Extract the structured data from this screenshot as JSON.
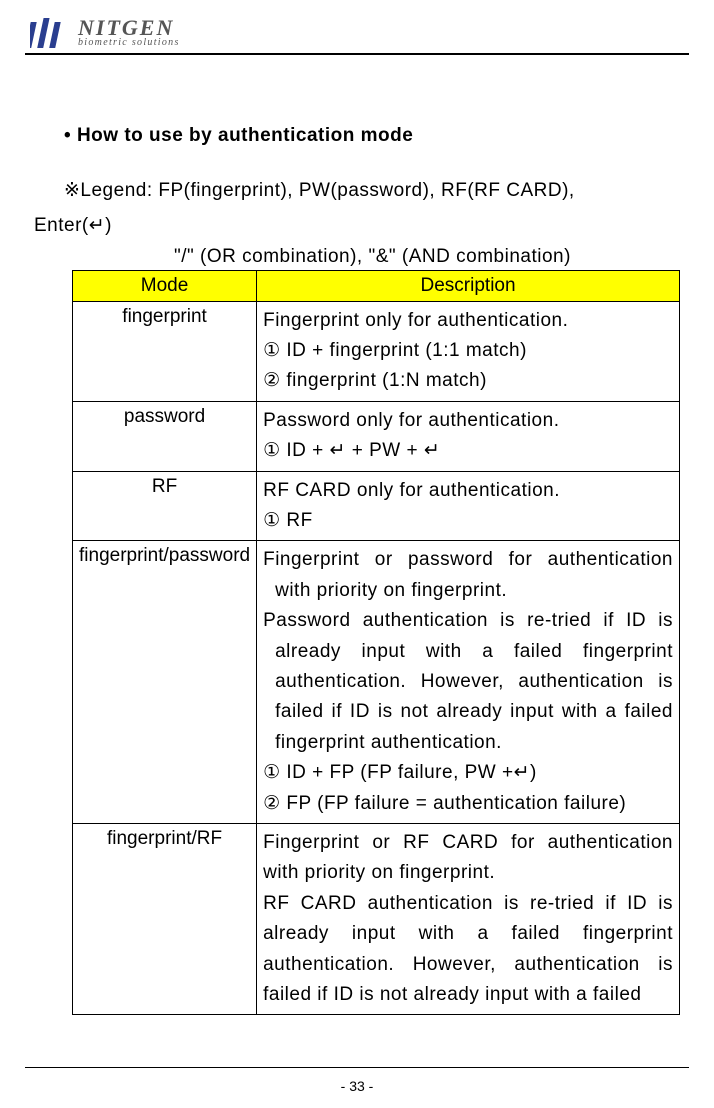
{
  "header": {
    "brand": "NITGEN",
    "sub": "biometric solutions"
  },
  "section": {
    "title": "How to use by authentication mode",
    "legend_prefix": "※Legend: FP(fingerprint), PW(password), RF(RF CARD),",
    "legend_enter": "Enter(↵)",
    "legend_ops": "\"/\" (OR combination),  \"&\" (AND combination)"
  },
  "table": {
    "head": {
      "mode": "Mode",
      "desc": "Description"
    },
    "rows": [
      {
        "mode": "fingerprint",
        "desc": "Fingerprint only for authentication.\n① ID + fingerprint (1:1 match)\n② fingerprint (1:N match)"
      },
      {
        "mode": "password",
        "desc": "Password only for authentication.\n① ID + ↵ + PW + ↵"
      },
      {
        "mode": "RF",
        "desc": "RF CARD only for authentication.\n① RF"
      },
      {
        "mode": "fingerprint/password",
        "p1": "Fingerprint or password for authentication with priority on fingerprint.",
        "p2": "Password authentication is re-tried if ID is already input with a failed fingerprint authentication. However, authentication is failed if ID is not already input with a failed fingerprint authentication.",
        "l1": "① ID + FP (FP failure, PW +↵)",
        "l2": "② FP (FP failure = authentication failure)"
      },
      {
        "mode": "fingerprint/RF",
        "p1": "Fingerprint or RF CARD for authentication with priority on fingerprint.",
        "p2": "RF CARD authentication is re-tried if ID is already input with a failed fingerprint authentication. However, authentication is failed if ID is not already input with a failed"
      }
    ]
  },
  "footer": {
    "page": "- 33 -"
  }
}
